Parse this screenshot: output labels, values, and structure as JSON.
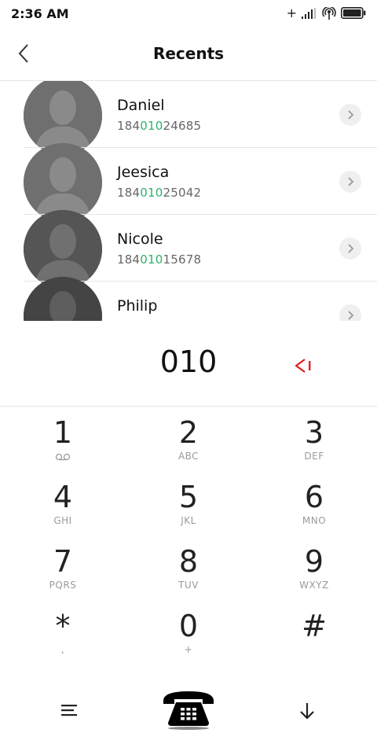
{
  "status": {
    "time": "2:36 AM",
    "plus": "+"
  },
  "header": {
    "title": "Recents"
  },
  "contacts": [
    {
      "name": "Daniel",
      "num_pre": "184",
      "num_match": "010",
      "num_post": "24685"
    },
    {
      "name": "Jeesica",
      "num_pre": "184",
      "num_match": "010",
      "num_post": "25042"
    },
    {
      "name": "Nicole",
      "num_pre": "184",
      "num_match": "010",
      "num_post": "15678"
    },
    {
      "name": "Philip",
      "num_pre": "",
      "num_match": "",
      "num_post": ""
    }
  ],
  "dialer": {
    "entered": "010"
  },
  "keys": [
    {
      "digit": "1",
      "sub": ""
    },
    {
      "digit": "2",
      "sub": "ABC"
    },
    {
      "digit": "3",
      "sub": "DEF"
    },
    {
      "digit": "4",
      "sub": "GHI"
    },
    {
      "digit": "5",
      "sub": "JKL"
    },
    {
      "digit": "6",
      "sub": "MNO"
    },
    {
      "digit": "7",
      "sub": "PQRS"
    },
    {
      "digit": "8",
      "sub": "TUV"
    },
    {
      "digit": "9",
      "sub": "WXYZ"
    },
    {
      "digit": "*",
      "sub": ","
    },
    {
      "digit": "0",
      "sub": "+"
    },
    {
      "digit": "#",
      "sub": ""
    }
  ],
  "colors": {
    "match": "#2bb36a",
    "backspace": "#e0201b"
  }
}
